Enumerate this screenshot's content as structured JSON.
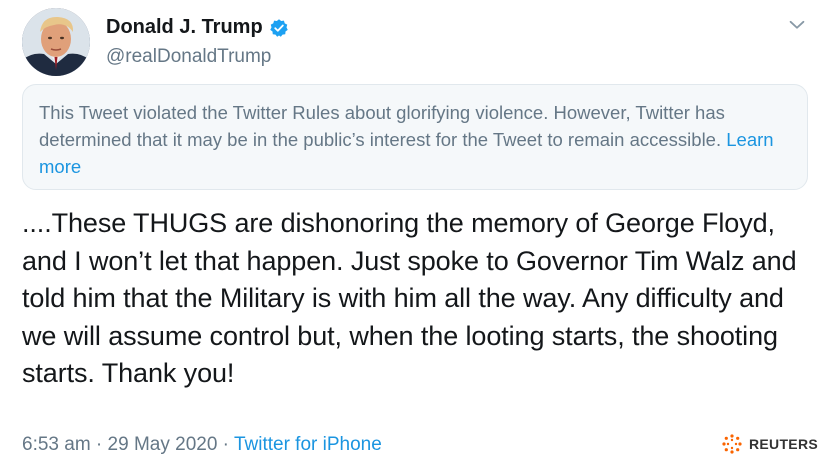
{
  "author": {
    "display_name": "Donald J. Trump",
    "handle": "@realDonaldTrump",
    "verified": true
  },
  "notice": {
    "text": "This Tweet violated the Twitter Rules about glorifying violence. However, Twitter has determined that it may be in the public’s interest for the Tweet to remain accessible. ",
    "link_label": "Learn more"
  },
  "tweet": {
    "text": "....These THUGS are dishonoring the memory of George Floyd, and I won’t let that happen. Just spoke to Governor Tim Walz and told him that the Military is with him all the way. Any difficulty and we will assume control but, when the looting starts, the shooting starts. Thank you!"
  },
  "meta": {
    "time": "6:53 am",
    "separator": " · ",
    "date": "29 May 2020",
    "source": "Twitter for iPhone"
  },
  "watermark": {
    "label": "REUTERS",
    "logo_icon": "reuters-logo-icon"
  },
  "colors": {
    "link": "#1b95e0",
    "secondary_text": "#657786",
    "primary_text": "#14171a",
    "notice_bg": "#f5f8fa",
    "verified": "#1da1f2",
    "reuters_orange": "#fa6400"
  }
}
